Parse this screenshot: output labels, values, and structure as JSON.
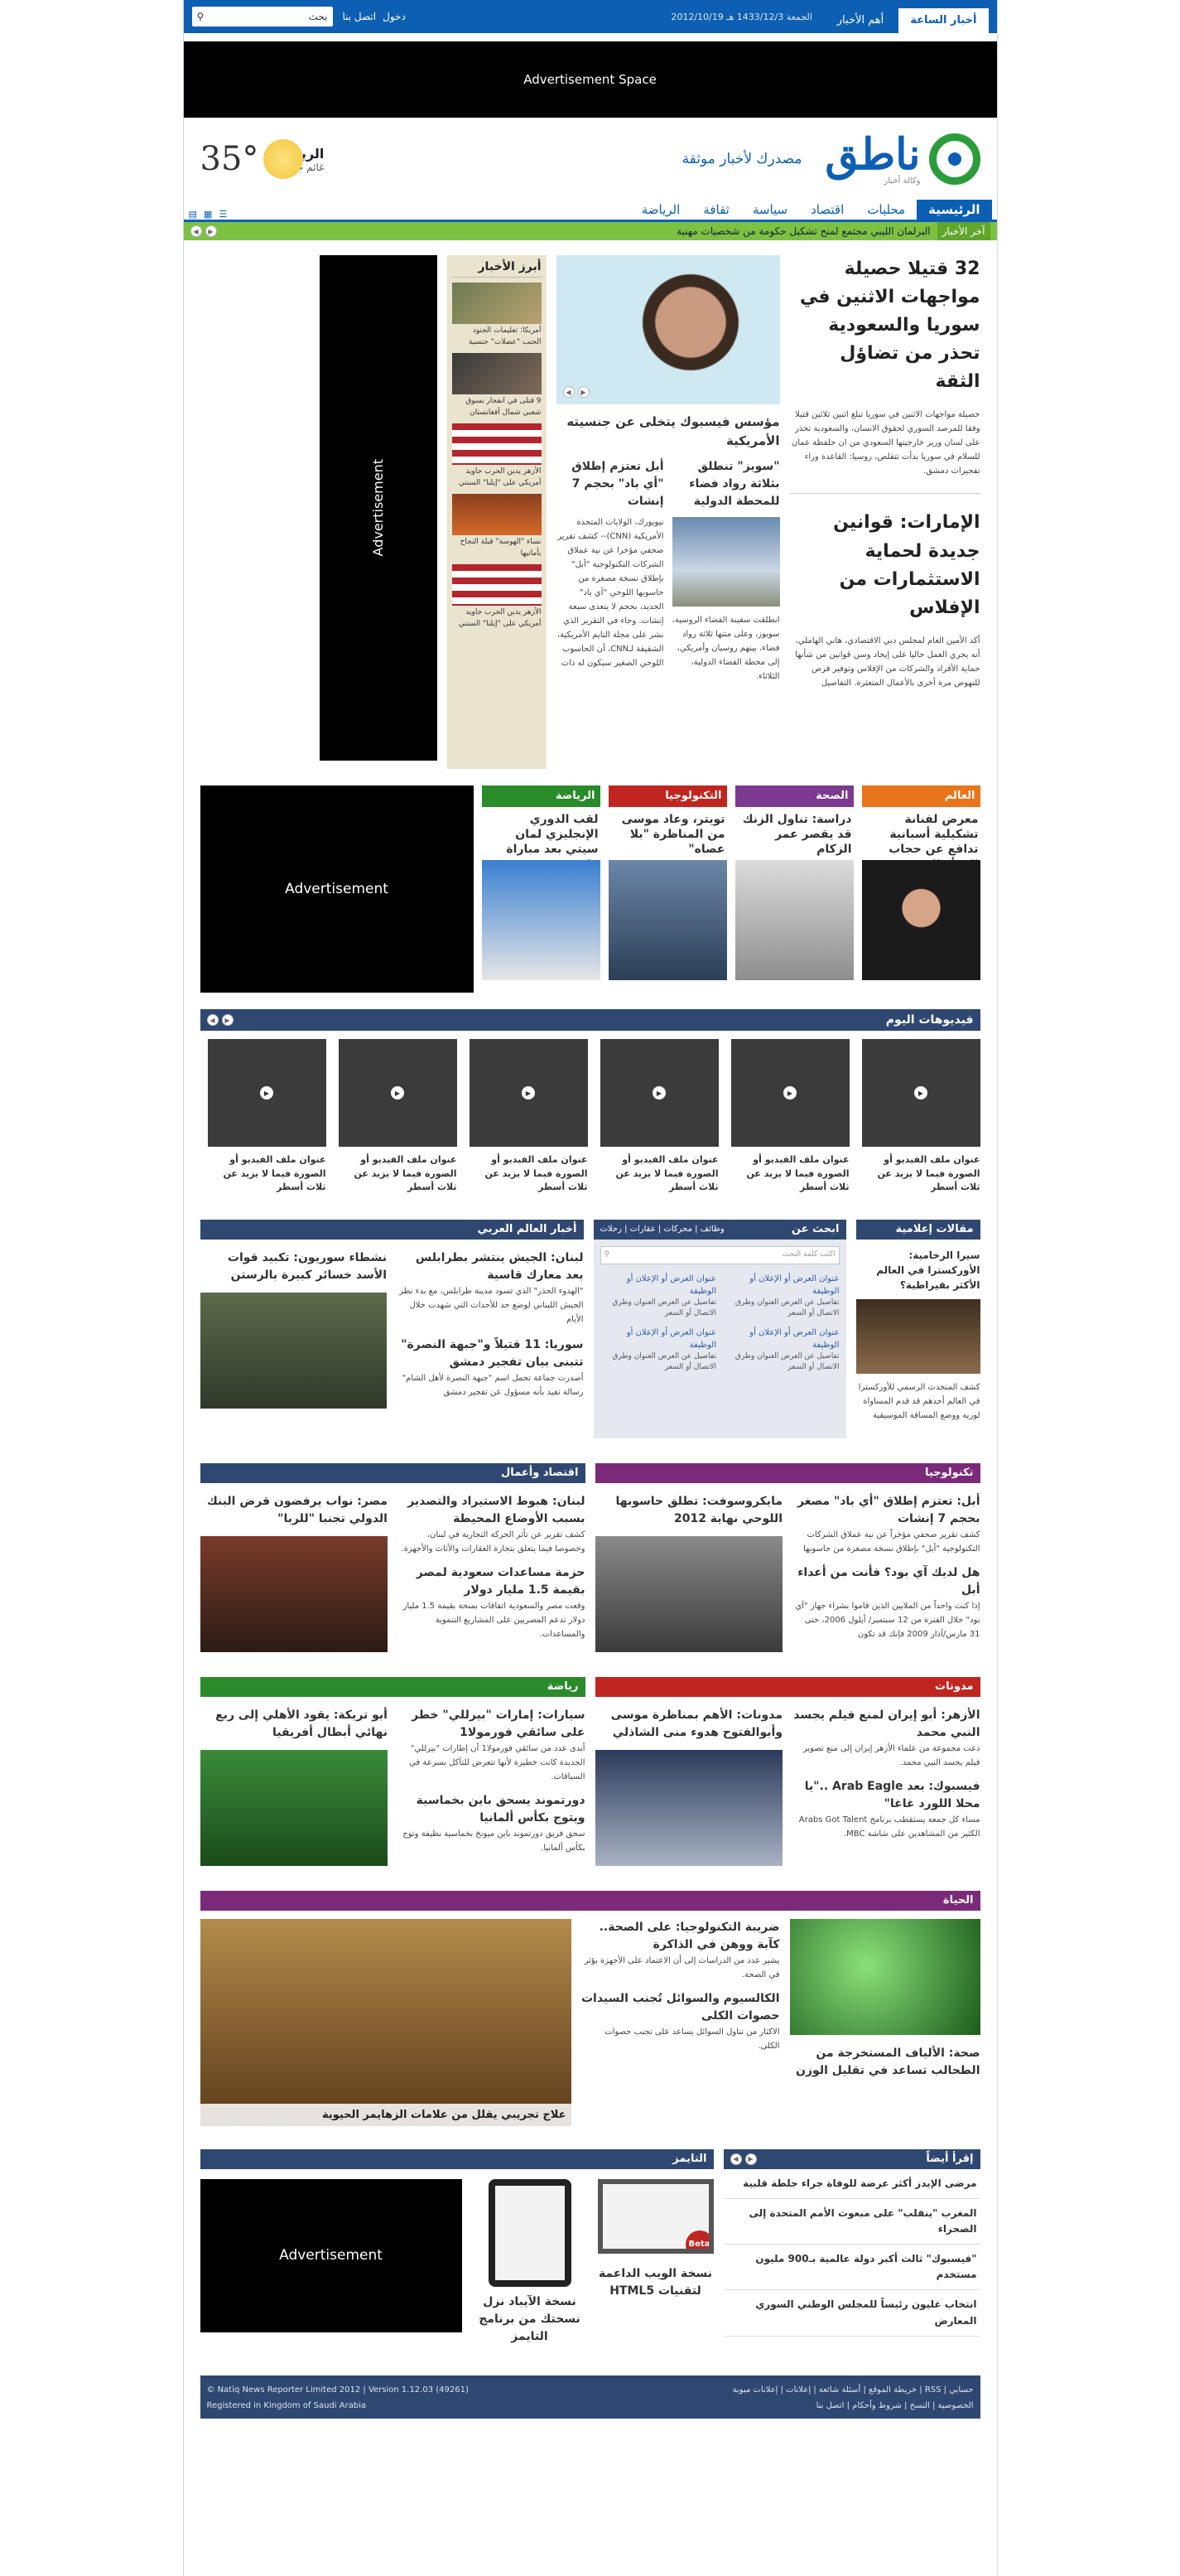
{
  "topbar": {
    "tabs": [
      "أخبار الساعة",
      "أهم الأخبار"
    ],
    "date": "الجمعة 1433/12/3 هـ 2012/10/19",
    "links": [
      "دخول",
      "اتصل بنا"
    ],
    "search": "بحث"
  },
  "ad_top": "Advertisement Space",
  "brand": {
    "name": "ناطق",
    "sub": "وكالة أخبار",
    "slogan": "مصدرك لأخبار موثقة",
    "weather": {
      "city": "الرياض",
      "cond": "غائم جزئي",
      "temp": "35°"
    }
  },
  "nav": [
    "الرئيسية",
    "محليات",
    "اقتصاد",
    "سياسة",
    "ثقافة",
    "الرياضة"
  ],
  "ticker": {
    "label": "آخر الأخبار",
    "text": "البرلمان الليبي مجتمع لمنح تشكيل حكومة من شخصيات مهنية"
  },
  "lead": {
    "title": "32 قتيلا حصيلة مواجهات الاثنين في سوريا والسعودية تحذر من تضاؤل الثقة",
    "text": "حصيلة مواجهات الاثنين في سوريا تبلغ اثنين ثلاثين قتيلا وفقا للمرصد السوري لحقوق الانسان، والسعودية تحذر على لسان وزير خارجيتها السعودي من ان حلفظة عمان للسلام في سوريا بدأت تتقلص، روسيا: القاعدة وراء تفجيرات دمشق.",
    "title2": "الإمارات: قوانين جديدة لحماية الاستثمارات من الإفلاس",
    "text2": "أكد الأمين العام لمجلس دبي الاقتصادي، هاني الهاملي، أنه يجري العمل حاليا على إيجاد وسن قوانين من شأنها حماية الأفراد والشركات من الإفلاس وتوفير فرص للنهوض مرة أخرى بالأعمال المتعثرة. التفاصيل"
  },
  "center": {
    "feature": "مؤسس فيسبوك يتخلى عن جنسيته الأمريكية",
    "story1": "\"سويز\" تنطلق بثلاثة رواد فضاء للمحطة الدولية",
    "story1_text": "انطلقت سفينة الفضاء الروسية، سويوز، وعلى متنها ثلاثة رواد فضاء، بينهم روسيان وأمريكي، إلى محطة الفضاء الدولية، الثلاثاء.",
    "story2": "أبل تعتزم إطلاق \"أي باد\" بحجم 7 إنشات",
    "story2_text": "نيويورك، الولايات المتحدة الأمريكية (CNN)-- كشف تقرير صحفي مؤخرا عن نية عملاق الشركات التكنولوجية \"أبل\" بإطلاق نسخة مصغرة من حاسوبها اللوحي \"آي باد\" الجديد، بحجم لا يتعدى سبعة إنشات. وجاء في التقرير الذي نشر على مجلة التايم الأمريكية، الشقيقة لـCNN، أن الحاسوب اللوحي الصغير سيكون له ذات"
  },
  "sidebar": {
    "title": "أبرز الأخبار",
    "items": [
      "أمريكا: تعليمات الجنود الجنب \"عضلات\" جنسية",
      "9 قتلى في انفجار بسوق شعبي شمال أفغانستان",
      "الأزهر يدين الحرب جاويد أمريكي على \"إيلنا\" السنتي",
      "نساء \"الهوسة\" قبلة النجاح بأمانيها",
      "الأزهر يدين الحرب جاويد أمريكي على \"إيلنا\" السنتي"
    ]
  },
  "ad_side": "Advertisement",
  "ad_big": "Advertisement",
  "cats": [
    {
      "bar": "العالم",
      "color": "#e8741b",
      "title": "معرض لفنانة تشكيلية أسبانية تدافع عن حجاب المرأة العربي"
    },
    {
      "bar": "الصحة",
      "color": "#7b3a8f",
      "title": "دراسة: تناول الزنك قد يقصر عمر الزكام"
    },
    {
      "bar": "التكنولوجيا",
      "color": "#c0261f",
      "title": "تويتر، وعاد موسى من المناظرة \"بلا عصاه\""
    },
    {
      "bar": "الرياضة",
      "color": "#2a8b2a",
      "title": "لقب الدوري الإنجليزي لمان سيتي بعد مباراة ملتهبة"
    }
  ],
  "videos": {
    "title": "فيديوهات اليوم",
    "caption": "عنوان ملف الفيديو أو الصورة فيما لا يزيد عن ثلاث أسطر"
  },
  "row3": {
    "arab": {
      "title": "أخبار العالم العربي",
      "a1": "لبنان: الجيش ينتشر بطرابلس بعد معارك قاسية",
      "a1t": "\"الهدوء الحذر\" الذي تسود مدينة طرابلس، مع بدء نظر الجيش اللبناني لوضع حد للأحداث التي شهدت خلال الأيام",
      "a2": "نشطاء سوريون: تكبيد قوات الأسد خسائر كبيرة بالرستن",
      "a3": "سوريا: 11 قتيلاً و\"جبهة النصرة\" تتبنى بيان تفجير دمشق",
      "a3t": "أصدرت جماعة تحمل اسم \"جبهة النصرة لأهل الشام\" رسالة تفيد بأنه مسؤول عن تفجير دمشق"
    },
    "jobs": {
      "title": "ابحث عن",
      "tabs": "وظائف | محركات | عقارات | رحلات",
      "placeholder": "اكتب كلمة البحث",
      "item": "عنوان العرض أو الإعلان أو الوظيفة",
      "detail": "تفاصيل عن العرض العنوان وطرق الاتصال أو السعر"
    },
    "posts": {
      "title": "مقالات إعلامية",
      "t": "سيرا الرخامية: الأوركسترا في العالم الأكثر بقيراطية؟",
      "x": "كشف المتحدث الرسمي للأوركسترا في العالم أحدهم قد قدم المساواة لوريه ووضع المساقة الموسيقية"
    }
  },
  "row4": {
    "econ": {
      "title": "اقتصاد وأعمال",
      "a1": "مصر: نواب يرفضون قرض البنك الدولي تجنبا \"للربا\"",
      "a2": "لبنان: هبوط الاستيراد والتصدير بسبب الأوضاع المحيطة",
      "a2t": "كشف تقرير عن تأثر الحركة التجارية في لبنان، وخصوصا فيما يتعلق بتجارة العقارات والأثاث والأجهزة.",
      "a3": "حزمة مساعدات سعودية لمصر بقيمة 1.5 مليار دولار",
      "a3t": "وقعت مصر والسعودية اتفاقات بمنحة بقيمة 1.5 مليار دولار تدعم المصريين على المشاريع التنموية والمساعدات."
    },
    "tech": {
      "title": "تكنولوجيا",
      "a1": "مايكروسوفت: تطلق حاسوبها اللوحي نهاية 2012",
      "a2": "أبل: تعتزم إطلاق \"أي باد\" مصغر بحجم 7 إنشات",
      "a2t": "كشف تقرير صحفي مؤخراً عن نية عملاق الشركات التكنولوجية \"أبل\" بإطلاق نسخة مصغرة من حاسوبها",
      "a3": "هل لديك آي بود؟ فأنت من أعداء أبل",
      "a3t": "إذا كنت واحداً من الملايين الذين قاموا بشراء جهاز \"آي بود\" خلال الفترة من 12 سبتمبر/ أيلول 2006، حتى 31 مارس/آذار 2009 فإنك قد تكون"
    }
  },
  "row5": {
    "sport": {
      "title": "رياضة",
      "a1": "أبو تريكة: يقود الأهلي إلى ربع نهائي أبطال أفريقيا",
      "a2": "سيارات: إمارات \"بيرللي\" خطر على سائقي فورمولا1",
      "a2t": "أبدى عدد من سائقي فورمولا1 أن إطارات \"بيرللي\" الجديدة كانت خطيرة لأنها تتعرض للتآكل بسرعة في السباقات.",
      "a3": "دورتموند يسحق باين بخماسية ويتوج بكأس ألمانيا",
      "a3t": "سحق فريق دورتموند باين ميونخ بخماسية نظيفة وتوج بكأس ألمانيا."
    },
    "blogs": {
      "title": "مدونات",
      "a1": "مدونات: الأهم بمناظرة موسى وأبوالفتوح هدوء منى الشاذلي",
      "a2": "الأزهر: أبو إيران لمنع فيلم يجسد النبي محمد",
      "a2t": "دعت مجموعة من علماء الأزهر إيران إلى منع تصوير فيلم يجسد النبي محمد.",
      "a3": "فيسبوك: بعد Arab Eagle ..\"يا محلا اللورد غاغا\"",
      "a3t": "مساء كل جمعة يستقطب برنامج Arabs Got Talent الكثير من المشاهدين على شاشة MBC."
    }
  },
  "life": {
    "title": "الحياة",
    "a1": "ضريبة التكنولوجيا: على الصحة.. كآبة ووهن في الذاكرة",
    "a1t": "يشير عدد من الدراسات إلى أن الاعتماد على الأجهزة يؤثر في الصحة.",
    "a2": "الكالسيوم والسوائل تُجنب السيدات حصوات الكلى",
    "a2t": "الاكثار من تناول السوائل يساعد على تجنب حصوات الكلى.",
    "a3": "صحة: الألياف المستخرجة من الطحالب تساعد في تقليل الوزن",
    "caption": "علاج تجريبي يقلل من علامات الزهايمر الحيوية"
  },
  "bottom": {
    "read": "إقرأ أيضاً",
    "list": [
      "مرضى الإيدز أكثر عرضة للوفاة جراء جلطة قلبية",
      "المغرب \"ينقلب\" على مبعوث الأمم المتحدة إلى الصحراء",
      "\"فيسبوك\" ثالث أكبر دولة عالمية بـ900 مليون مستخدم",
      "انتخاب غليون رئيساً للمجلس الوطني السوري المعارض"
    ],
    "times": "التايمز",
    "t1": "نسخة الويب الداعمة لتقنيات HTML5",
    "t2": "نسخة الآيباد نزل نسختك من برنامج التايمز",
    "beta": "Beta",
    "ad": "Advertisement"
  },
  "footer": {
    "links": "حسابي | RSS | خريطة الموقع | أسئلة شائعة | إعلانات | إعلانات مبوبة",
    "links2": "الخصوصية | النسخ | شروط وأحكام | اتصل بنا",
    "copy": "© Natiq News Reporter Limited 2012 | Version 1.12.03 (49261)",
    "reg": "Registered in Kingdom of Saudi Arabia"
  }
}
